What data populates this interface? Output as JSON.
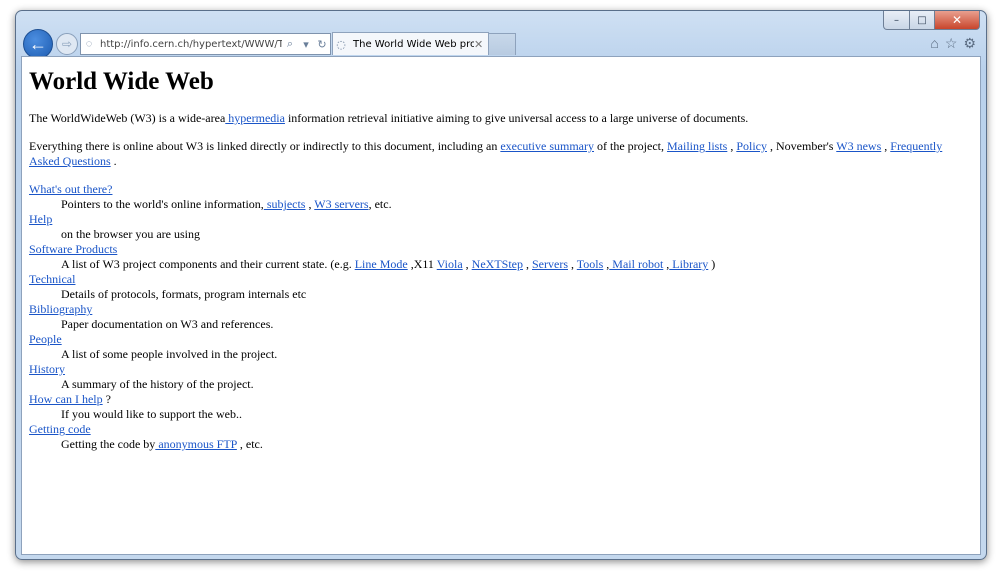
{
  "browser": {
    "address_url": "http://info.cern.ch/hypertext/WWW/ThePr",
    "tab_title": "The World Wide Web project",
    "caption": {
      "minimize": "–",
      "maximize": "□",
      "close": "✕"
    },
    "icons": {
      "back": "back-arrow-icon",
      "forward": "forward-arrow-icon",
      "home": "home-icon",
      "favorites": "star-icon",
      "settings": "gear-icon"
    }
  },
  "page": {
    "title": "World Wide Web",
    "intro": {
      "text_before": "The WorldWideWeb (W3) is a wide-area",
      "link": " hypermedia",
      "text_after": " information retrieval initiative aiming to give universal access to a large universe of documents."
    },
    "everything": {
      "t1": "Everything there is online about W3 is linked directly or indirectly to this document, including an ",
      "l1": "executive summary",
      "t2": " of the project, ",
      "l2": "Mailing lists",
      "t3": " , ",
      "l3": "Policy",
      "t4": " , November's ",
      "l4": "W3 news",
      "t5": " , ",
      "l5": "Frequently Asked Questions",
      "t6": " ."
    },
    "sections": {
      "out_there": {
        "link": "What's out there?",
        "d1": "Pointers to the world's online information,",
        "l1": " subjects",
        "d2": " , ",
        "l2": "W3 servers",
        "d3": ", etc."
      },
      "help": {
        "link": "Help",
        "desc": "on the browser you are using"
      },
      "software": {
        "link": "Software Products",
        "d1": "A list of W3 project components and their current state. (e.g. ",
        "l1": "Line Mode",
        "d2": " ,X11 ",
        "l2": "Viola",
        "d3": " , ",
        "l3": "NeXTStep",
        "d4": " , ",
        "l4": "Servers",
        "d5": " , ",
        "l5": "Tools",
        "d6": " ,",
        "l6": " Mail robot",
        "d7": " ,",
        "l7": " Library",
        "d8": " )"
      },
      "technical": {
        "link": "Technical",
        "desc": "Details of protocols, formats, program internals etc"
      },
      "bibliography": {
        "link": "Bibliography",
        "desc": "Paper documentation on W3 and references."
      },
      "people": {
        "link": "People",
        "desc": "A list of some people involved in the project."
      },
      "history": {
        "link": "History",
        "desc": "A summary of the history of the project."
      },
      "howhelp": {
        "link": "How can I help",
        "after": " ?",
        "desc": "If you would like to support the web.."
      },
      "getting": {
        "link": "Getting code",
        "d1": "Getting the code by",
        "l1": " anonymous FTP",
        "d2": " , etc."
      }
    }
  }
}
